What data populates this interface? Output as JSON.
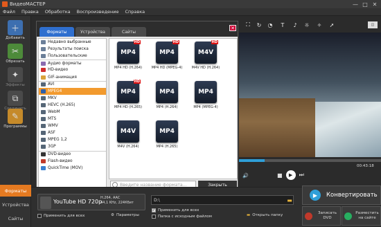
{
  "window": {
    "title": "ВидеоМАСТЕР",
    "buttons": [
      "—",
      "□",
      "✕"
    ]
  },
  "menu": [
    "Файл",
    "Правка",
    "Обработка",
    "Воспроизведение",
    "Справка"
  ],
  "left_panel": {
    "buttons": [
      {
        "label": "Добавить",
        "icon": "add-file-icon",
        "enabled": true
      },
      {
        "label": "Обрезать",
        "icon": "scissors-icon",
        "enabled": true
      },
      {
        "label": "Эффекты",
        "icon": "effects-icon",
        "enabled": false
      },
      {
        "label": "Соединить",
        "icon": "join-icon",
        "enabled": false
      },
      {
        "label": "Программы",
        "icon": "programs-icon",
        "enabled": true
      }
    ],
    "tabs": [
      "Форматы",
      "Устройства",
      "Сайты"
    ]
  },
  "dialog": {
    "tabs": [
      "Форматы",
      "Устройства",
      "Сайты"
    ],
    "active_tab": "Форматы",
    "categories": [
      {
        "label": "Недавно выбранные",
        "color": "#6b7f99"
      },
      {
        "label": "Результаты поиска",
        "color": "#6b7f99"
      },
      {
        "label": "Пользовательские",
        "color": "#6b7f99"
      },
      {
        "label": "Аудио форматы",
        "color": "#8a6bb0",
        "sep": true
      },
      {
        "label": "HD-видео",
        "color": "#d12d2d"
      },
      {
        "label": "GIF-анимация",
        "color": "#d9a23a"
      },
      {
        "label": "AVI",
        "color": "#556677",
        "sep": true
      },
      {
        "label": "MPEG4",
        "color": "#2f5fa8",
        "selected": true
      },
      {
        "label": "MKV",
        "color": "#556677"
      },
      {
        "label": "HEVC (H.265)",
        "color": "#556677"
      },
      {
        "label": "WebM",
        "color": "#556677"
      },
      {
        "label": "MTS",
        "color": "#556677"
      },
      {
        "label": "WMV",
        "color": "#556677"
      },
      {
        "label": "ASF",
        "color": "#556677"
      },
      {
        "label": "MPEG 1,2",
        "color": "#556677"
      },
      {
        "label": "3GP",
        "color": "#556677"
      },
      {
        "label": "DVD-видео",
        "color": "#333333",
        "sep": true
      },
      {
        "label": "Flash-видео",
        "color": "#c0392b"
      },
      {
        "label": "QuickTime (MOV)",
        "color": "#3a7fd0"
      }
    ],
    "formats": [
      {
        "tile": "MP4",
        "hd": true,
        "label": "MP4 HD (H.264)"
      },
      {
        "tile": "MP4",
        "hd": true,
        "label": "MP4 HD (MPEG-4)"
      },
      {
        "tile": "M4V",
        "hd": true,
        "label": "M4V HD (H.264)"
      },
      {
        "tile": "MP4",
        "hd": true,
        "label": "MP4 HD (H.265)"
      },
      {
        "tile": "MP4",
        "hd": false,
        "label": "MP4 (H.264)"
      },
      {
        "tile": "MP4",
        "hd": false,
        "label": "MP4 (MPEG-4)"
      },
      {
        "tile": "M4V",
        "hd": false,
        "label": "M4V (H.264)"
      },
      {
        "tile": "MP4",
        "hd": false,
        "label": "MP4 (H.265)"
      }
    ],
    "search_placeholder": "Введите название формата...",
    "close_label": "Закрыть",
    "close_icon": "✕"
  },
  "player": {
    "time": "00:43:18",
    "progress": 0.18
  },
  "bottom": {
    "format_name": "YouTube HD 720p",
    "format_spec": [
      "H.264, AAC",
      "44,1 KHz, 224Кбит"
    ],
    "path": "D:\\",
    "apply_all_top": "Применить для всех",
    "source_folder": "Папка с исходным файлом",
    "apply_all_left": "Применить для всех",
    "params": "Параметры",
    "open_folder": "Открыть папку",
    "convert": "Конвертировать",
    "dvd": "Записать DVD",
    "publish": "Разместить на сайте"
  }
}
